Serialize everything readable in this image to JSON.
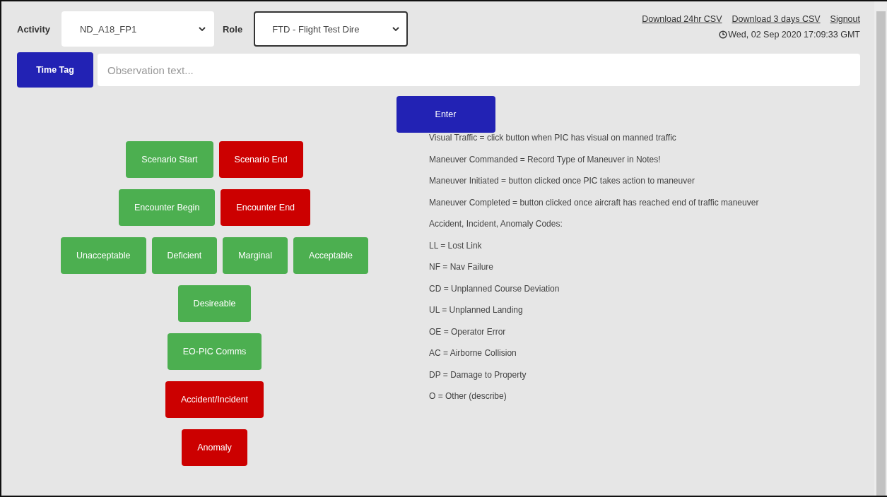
{
  "activity": {
    "label": "Activity",
    "value": "ND_A18_FP1",
    "focused": false
  },
  "role": {
    "label": "Role",
    "value": "FTD - Flight Test Dire",
    "focused": true
  },
  "links": [
    "Download 24hr CSV",
    "Download 3 days CSV",
    "Signout"
  ],
  "timestamp": "Wed, 02 Sep 2020 17:09:33 GMT",
  "time_tag_button": "Time Tag",
  "observation": {
    "placeholder": "Observation text..."
  },
  "enter_button": "Enter",
  "button_rows": [
    [
      {
        "label": "Scenario Start",
        "kind": "success"
      },
      {
        "label": "Scenario End",
        "kind": "danger"
      }
    ],
    [
      {
        "label": "Encounter Begin",
        "kind": "success"
      },
      {
        "label": "Encounter End",
        "kind": "danger"
      }
    ],
    [
      {
        "label": "Unacceptable",
        "kind": "success"
      },
      {
        "label": "Deficient",
        "kind": "success"
      },
      {
        "label": "Marginal",
        "kind": "success"
      },
      {
        "label": "Acceptable",
        "kind": "success"
      }
    ],
    [
      {
        "label": "Desireable",
        "kind": "success"
      }
    ],
    [
      {
        "label": "EO-PIC Comms",
        "kind": "success"
      }
    ],
    [
      {
        "label": "Accident/Incident",
        "kind": "danger"
      }
    ],
    [
      {
        "label": "Anomaly",
        "kind": "danger"
      }
    ]
  ],
  "notes": [
    "Visual Traffic = click button when PIC has visual on manned traffic",
    "Maneuver Commanded = Record Type of Maneuver in Notes!",
    "Maneuver Initiated = button clicked once PIC takes action to maneuver",
    "Maneuver Completed = button clicked once aircraft has reached end of traffic maneuver",
    "Accident, Incident, Anomaly Codes:",
    "LL = Lost Link",
    "NF = Nav Failure",
    "CD = Unplanned Course Deviation",
    "UL = Unplanned Landing",
    "OE = Operator Error",
    "AC = Airborne Collision",
    "DP = Damage to Property",
    "O = Other (describe)"
  ]
}
